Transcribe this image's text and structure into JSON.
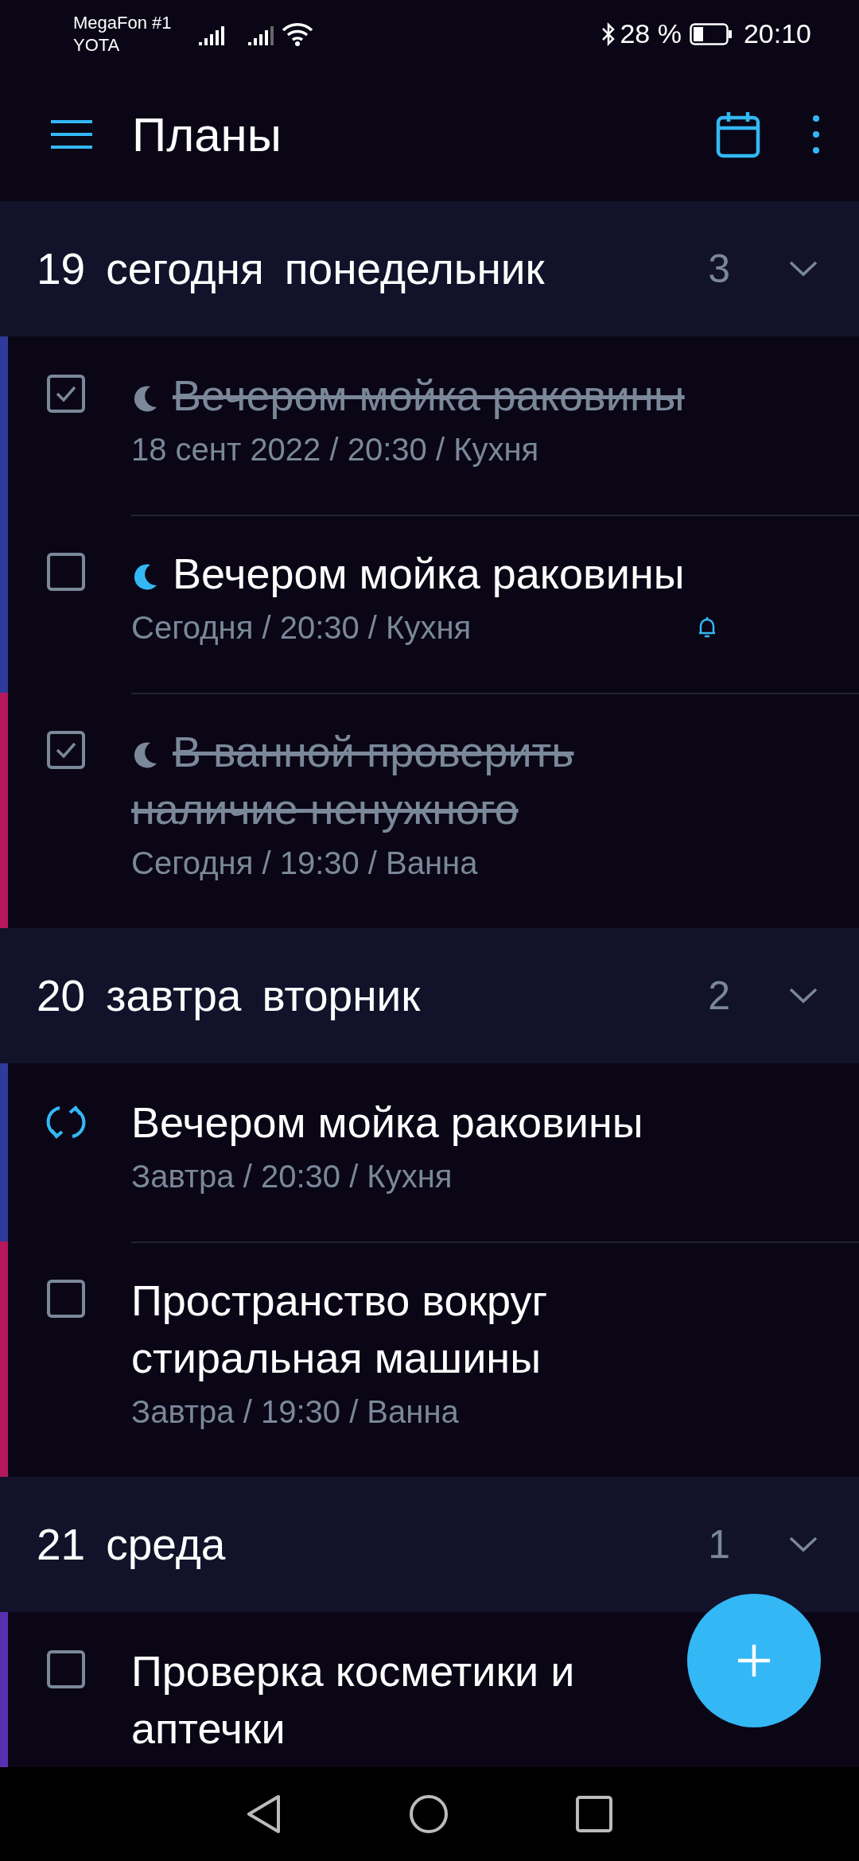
{
  "status_bar": {
    "carrier_1": "MegaFon #1",
    "carrier_2": "YOTA",
    "battery": "28 %",
    "time": "20:10"
  },
  "app_bar": {
    "title": "Планы"
  },
  "sections": [
    {
      "day": "19",
      "relative": "сегодня",
      "weekday": "понедельник",
      "count": "3",
      "expanded": true,
      "tasks": [
        {
          "kind": "checkbox",
          "done": true,
          "evening": true,
          "reminder": false,
          "color": "#2f3a9c",
          "title": "Вечером мойка раковины",
          "meta": "18 сент 2022 / 20:30 / Кухня"
        },
        {
          "kind": "checkbox",
          "done": false,
          "evening": true,
          "reminder": true,
          "color": "#2f3a9c",
          "title": "Вечером мойка раковины",
          "meta": "Сегодня / 20:30 / Кухня"
        },
        {
          "kind": "checkbox",
          "done": true,
          "evening": true,
          "reminder": false,
          "color": "#b5185c",
          "title": "В ванной проверить наличие ненужного",
          "meta": "Сегодня / 19:30 / Ванна"
        }
      ]
    },
    {
      "day": "20",
      "relative": "завтра",
      "weekday": "вторник",
      "count": "2",
      "expanded": true,
      "tasks": [
        {
          "kind": "repeat",
          "done": false,
          "evening": false,
          "reminder": false,
          "color": "#2f3a9c",
          "title": "Вечером мойка раковины",
          "meta": "Завтра / 20:30 / Кухня"
        },
        {
          "kind": "checkbox",
          "done": false,
          "evening": false,
          "reminder": false,
          "color": "#b5185c",
          "title": "Пространство вокруг стиральная машины",
          "meta": "Завтра / 19:30 / Ванна"
        }
      ]
    },
    {
      "day": "21",
      "weekday": "среда",
      "count": "1",
      "expanded": true,
      "tasks": [
        {
          "kind": "checkbox",
          "done": false,
          "evening": false,
          "reminder": false,
          "color": "#5630b0",
          "title": "Проверка косметики и аптечки"
        }
      ]
    }
  ]
}
